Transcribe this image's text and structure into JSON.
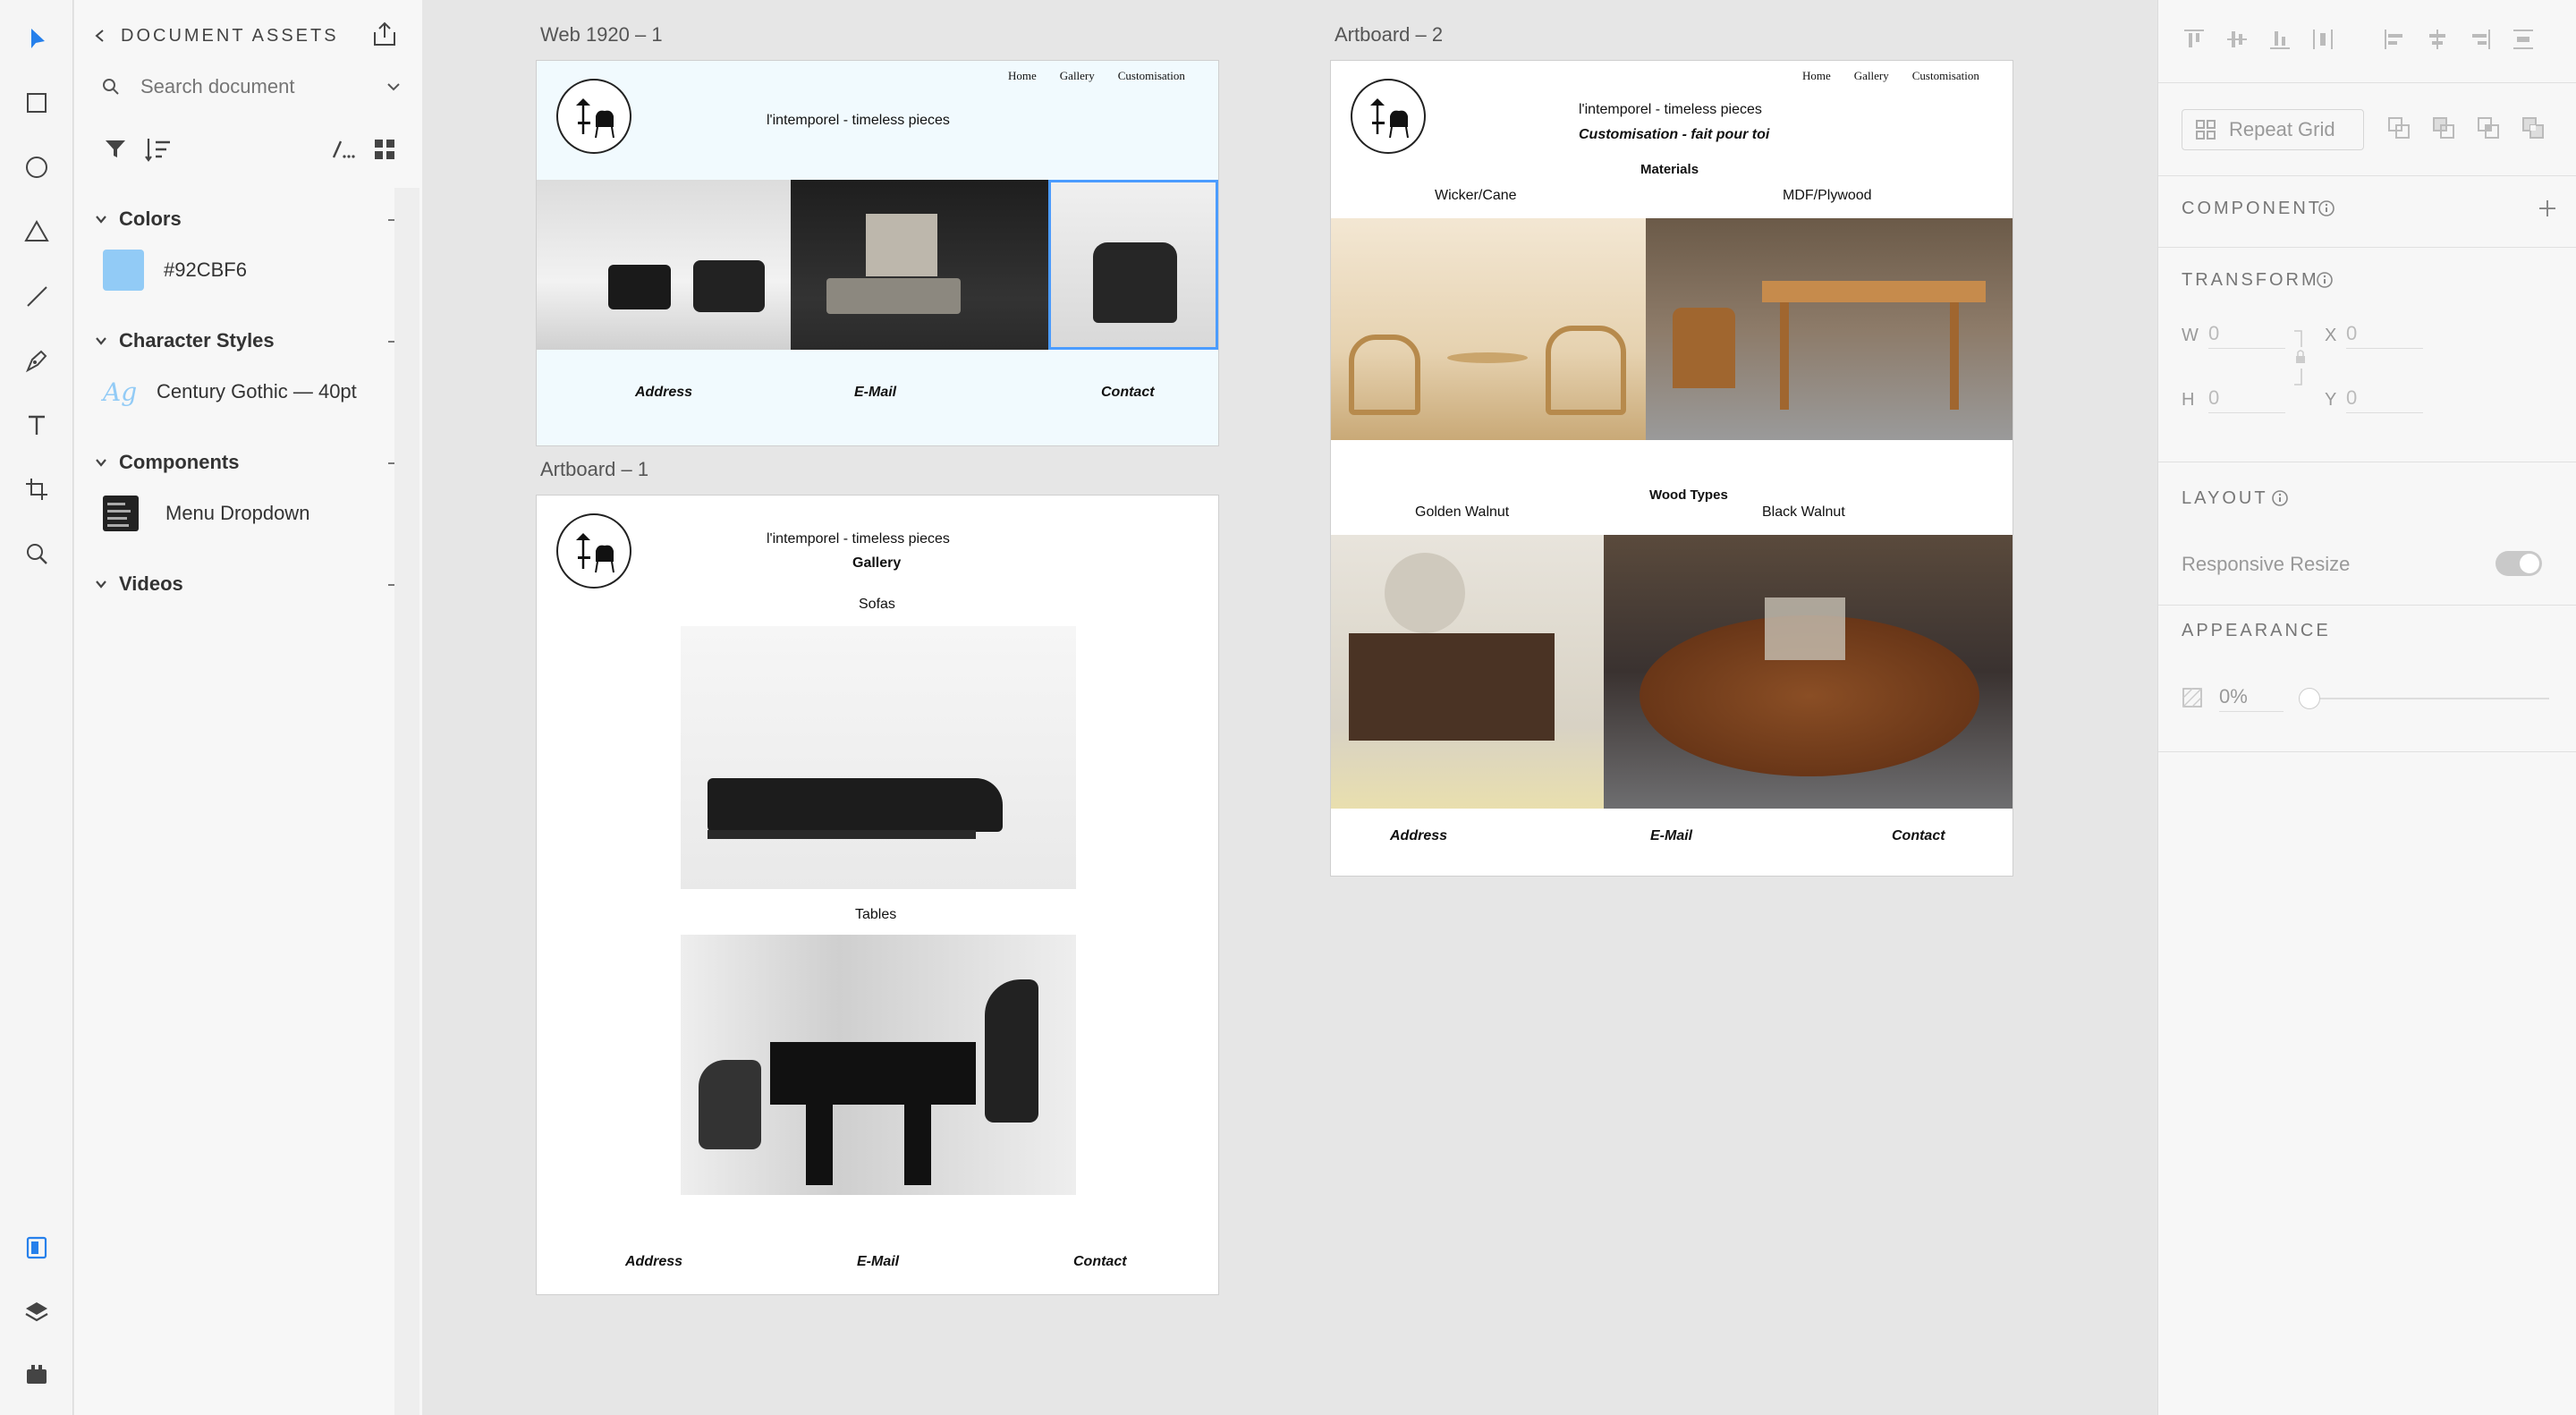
{
  "assets_panel": {
    "title": "DOCUMENT ASSETS",
    "search_placeholder": "Search document",
    "sections": {
      "colors": {
        "label": "Colors",
        "items": [
          {
            "hex": "#92CBF6",
            "label": "#92CBF6"
          }
        ]
      },
      "character_styles": {
        "label": "Character Styles",
        "items": [
          {
            "preview": "Ag",
            "label": "Century Gothic — 40pt"
          }
        ]
      },
      "components": {
        "label": "Components",
        "items": [
          {
            "label": "Menu Dropdown"
          }
        ]
      },
      "videos": {
        "label": "Videos"
      }
    }
  },
  "canvas": {
    "web1920": {
      "label": "Web 1920 – 1",
      "background": "#F1FAFE",
      "nav": [
        "Home",
        "Gallery",
        "Customisation"
      ],
      "tagline": "l'intemporel - timeless pieces",
      "footer": [
        "Address",
        "E-Mail",
        "Contact"
      ]
    },
    "artboard1": {
      "label": "Artboard – 1",
      "tagline": "l'intemporel - timeless pieces",
      "heading": "Gallery",
      "sections": [
        "Sofas",
        "Tables"
      ],
      "footer": [
        "Address",
        "E-Mail",
        "Contact"
      ]
    },
    "artboard2": {
      "label": "Artboard – 2",
      "nav": [
        "Home",
        "Gallery",
        "Customisation"
      ],
      "tagline": "l'intemporel - timeless pieces",
      "subtitle": "Customisation - fait pour toi",
      "materials_heading": "Materials",
      "materials": [
        "Wicker/Cane",
        "MDF/Plywood"
      ],
      "wood_heading": "Wood Types",
      "woods": [
        "Golden Walnut",
        "Black Walnut"
      ],
      "footer": [
        "Address",
        "E-Mail",
        "Contact"
      ]
    }
  },
  "inspector": {
    "repeat_grid": "Repeat Grid",
    "component_label": "COMPONENT",
    "transform_label": "TRANSFORM",
    "transform": {
      "w_label": "W",
      "w": "0",
      "h_label": "H",
      "h": "0",
      "x_label": "X",
      "x": "0",
      "y_label": "Y",
      "y": "0"
    },
    "layout_label": "LAYOUT",
    "responsive_resize": "Responsive Resize",
    "appearance_label": "APPEARANCE",
    "opacity": "0%"
  },
  "colors": {
    "accent": "#2680EB",
    "swatch": "#92CBF6",
    "selection": "#4B9CFF"
  }
}
